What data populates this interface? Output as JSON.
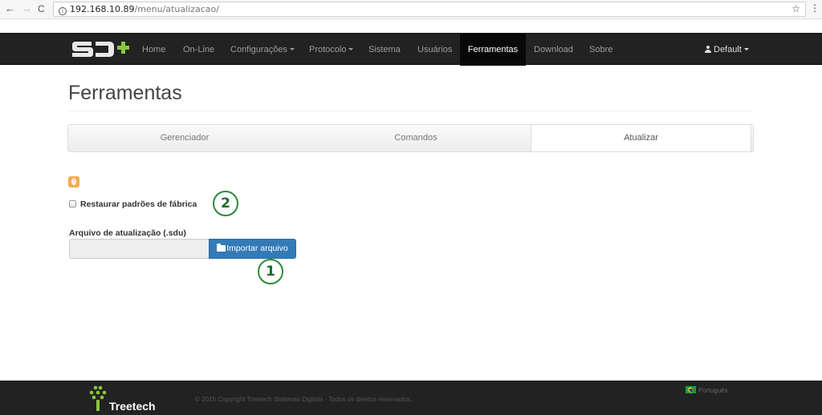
{
  "browser": {
    "url_host": "192.168.10.89",
    "url_path": "/menu/atualizacao/",
    "back_icon": "←",
    "forward_icon": "→",
    "reload_icon": "C",
    "info_icon": "i",
    "star_icon": "☆",
    "menu_icon": "⋮"
  },
  "nav": {
    "items": [
      "Home",
      "On-Line",
      "Configurações",
      "Protocolo",
      "Sistema",
      "Usuários",
      "Ferramentas",
      "Download",
      "Sobre"
    ],
    "user_label": "Default"
  },
  "page": {
    "title": "Ferramentas",
    "tabs": [
      "Gerenciador",
      "Comandos",
      "Atualizar"
    ],
    "checkbox_label": "Restaurar padrões de fábrica",
    "file_label": "Arquivo de atualização (.sdu)",
    "file_value": "",
    "import_button": "Importar arquivo",
    "markers": [
      "1",
      "2"
    ]
  },
  "footer": {
    "brand": "Treetech",
    "copyright": "© 2015 Copyright Treetech Sistemas Digitais · Todos os direitos reservados.",
    "language": "Português"
  },
  "colors": {
    "navbar": "#222222",
    "primary_button": "#337ab7",
    "help_badge": "#f0ad4e",
    "marker": "#2d8a3a",
    "logo_green": "#8bc53f"
  }
}
